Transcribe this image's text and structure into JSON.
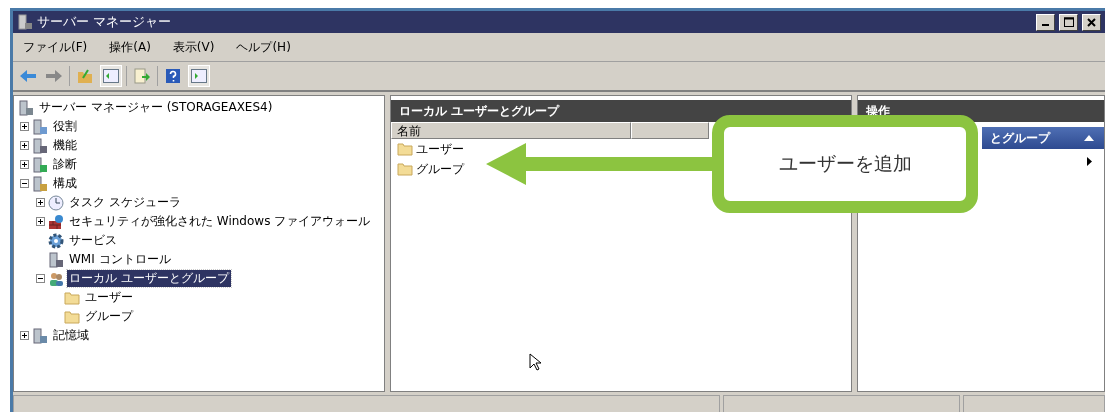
{
  "window": {
    "title": "サーバー マネージャー"
  },
  "menu": [
    "ファイル(F)",
    "操作(A)",
    "表示(V)",
    "ヘルプ(H)"
  ],
  "toolbar": [
    {
      "kind": "back",
      "pressed": false
    },
    {
      "kind": "forward",
      "pressed": false
    },
    {
      "kind": "sep"
    },
    {
      "kind": "up",
      "pressed": false
    },
    {
      "kind": "tree",
      "pressed": true
    },
    {
      "kind": "sep"
    },
    {
      "kind": "export",
      "pressed": false
    },
    {
      "kind": "sep"
    },
    {
      "kind": "help",
      "pressed": false
    },
    {
      "kind": "action",
      "pressed": true
    }
  ],
  "tree": {
    "label": "サーバー マネージャー (STORAGEAXES4)",
    "kind": "server",
    "selected": false,
    "children": [
      {
        "label": "役割",
        "kind": "roles",
        "expanded": false,
        "selected": false
      },
      {
        "label": "機能",
        "kind": "features",
        "expanded": false,
        "selected": false
      },
      {
        "label": "診断",
        "kind": "diag",
        "expanded": false,
        "selected": false
      },
      {
        "label": "構成",
        "kind": "config",
        "expanded": true,
        "selected": false,
        "children": [
          {
            "label": "タスク スケジューラ",
            "kind": "clock",
            "expanded": false,
            "selected": false
          },
          {
            "label": "セキュリティが強化された Windows ファイアウォール",
            "kind": "firewall",
            "expanded": false,
            "selected": false
          },
          {
            "label": "サービス",
            "kind": "gear",
            "selected": false
          },
          {
            "label": "WMI コントロール",
            "kind": "wmi",
            "selected": false
          },
          {
            "label": "ローカル ユーザーとグループ",
            "kind": "users",
            "expanded": true,
            "selected": true,
            "children": [
              {
                "label": "ユーザー",
                "kind": "folder",
                "selected": false
              },
              {
                "label": "グループ",
                "kind": "folder",
                "selected": false
              }
            ]
          }
        ]
      },
      {
        "label": "記憶域",
        "kind": "storage",
        "expanded": false,
        "selected": false
      }
    ]
  },
  "content": {
    "title": "ローカル ユーザーとグループ",
    "columns": [
      "名前"
    ],
    "rows": [
      "ユーザー",
      "グループ"
    ]
  },
  "actions": {
    "title": "操作",
    "section": "とグループ",
    "section_expanded": true
  },
  "callout": {
    "text": "ユーザーを追加"
  }
}
